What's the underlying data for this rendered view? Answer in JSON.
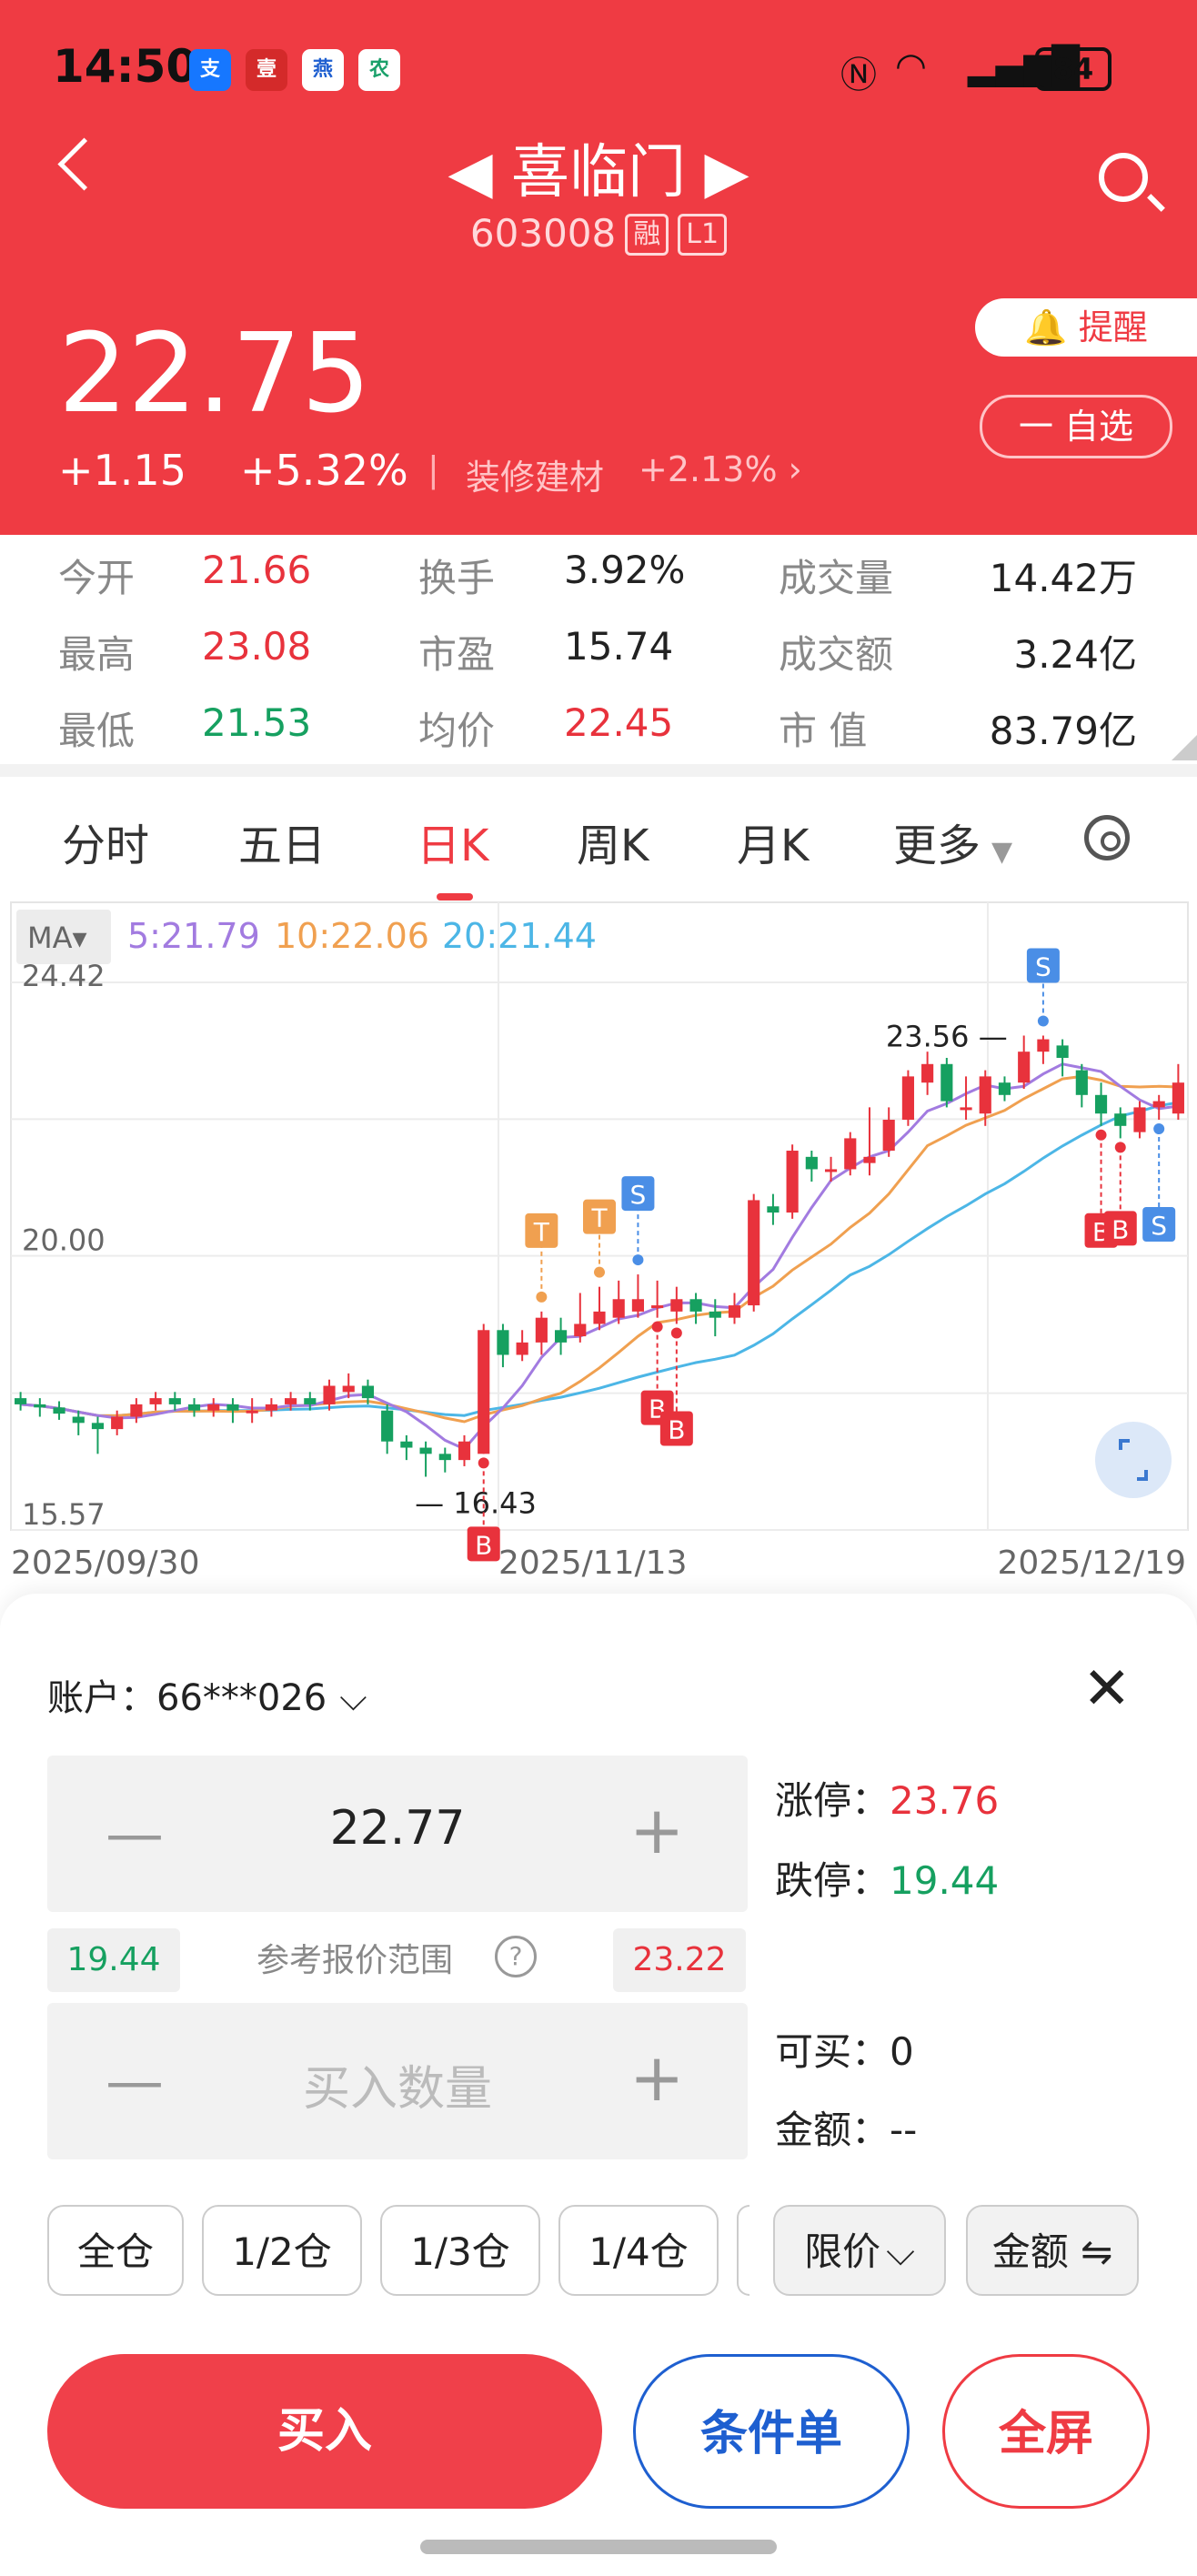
{
  "status_bar": {
    "time": "14:50",
    "battery": "84",
    "apps": [
      "支",
      "壹",
      "燕",
      "农"
    ]
  },
  "header": {
    "title": "◀ 喜临门 ▶",
    "code": "603008",
    "tag1": "融",
    "tag2": "L1",
    "price": "22.75",
    "change": "+1.15",
    "change_pct": "+5.32%",
    "sector": "装修建材",
    "sector_pct": "+2.13% ›",
    "remind": "提醒",
    "watchlist": "一 自选"
  },
  "stats": {
    "open_label": "今开",
    "open": "21.66",
    "high_label": "最高",
    "high": "23.08",
    "low_label": "最低",
    "low": "21.53",
    "turnover_label": "换手",
    "turnover": "3.92%",
    "pe_label": "市盈",
    "pe": "15.74",
    "avg_label": "均价",
    "avg": "22.45",
    "vol_label": "成交量",
    "vol": "14.42万",
    "amount_label": "成交额",
    "amount": "3.24亿",
    "mcap_label": "市 值",
    "mcap": "83.79亿"
  },
  "tabs": [
    "分时",
    "五日",
    "日K",
    "周K",
    "月K",
    "更多"
  ],
  "active_tab": "日K",
  "chart_data": {
    "type": "candlestick",
    "ma_button": "MA",
    "ma5": "5:21.79",
    "ma10": "10:22.06",
    "ma20": "20:21.44",
    "y_ticks": [
      "24.42",
      "20.00",
      "15.57"
    ],
    "ylim": [
      15.57,
      24.42
    ],
    "x_labels": [
      "2025/09/30",
      "2025/11/13",
      "2025/12/19"
    ],
    "max_label": "23.56",
    "min_label": "16.43",
    "colors": {
      "ma5": "#a27be0",
      "ma10": "#f0a050",
      "ma20": "#4cb6e6",
      "up": "#e8323c",
      "down": "#16a060"
    },
    "candles": [
      [
        17.7,
        17.6,
        17.8,
        17.5
      ],
      [
        17.6,
        17.55,
        17.7,
        17.4
      ],
      [
        17.55,
        17.45,
        17.65,
        17.35
      ],
      [
        17.4,
        17.3,
        17.5,
        17.1
      ],
      [
        17.3,
        17.2,
        17.4,
        16.8
      ],
      [
        17.2,
        17.4,
        17.5,
        17.1
      ],
      [
        17.4,
        17.6,
        17.7,
        17.3
      ],
      [
        17.6,
        17.7,
        17.8,
        17.5
      ],
      [
        17.7,
        17.6,
        17.8,
        17.5
      ],
      [
        17.6,
        17.5,
        17.7,
        17.4
      ],
      [
        17.5,
        17.6,
        17.7,
        17.4
      ],
      [
        17.6,
        17.5,
        17.7,
        17.3
      ],
      [
        17.5,
        17.5,
        17.7,
        17.3
      ],
      [
        17.5,
        17.6,
        17.7,
        17.4
      ],
      [
        17.6,
        17.7,
        17.8,
        17.5
      ],
      [
        17.7,
        17.6,
        17.8,
        17.5
      ],
      [
        17.6,
        17.9,
        18.0,
        17.5
      ],
      [
        17.8,
        17.9,
        18.1,
        17.7
      ],
      [
        17.9,
        17.7,
        18.0,
        17.6
      ],
      [
        17.5,
        17.0,
        17.6,
        16.8
      ],
      [
        17.0,
        16.9,
        17.1,
        16.7
      ],
      [
        16.9,
        16.8,
        17.0,
        16.43
      ],
      [
        16.8,
        16.7,
        16.9,
        16.5
      ],
      [
        16.7,
        17.0,
        17.1,
        16.6
      ],
      [
        16.8,
        18.8,
        18.9,
        16.8
      ],
      [
        18.8,
        18.4,
        18.9,
        18.2
      ],
      [
        18.4,
        18.6,
        18.8,
        18.3
      ],
      [
        18.6,
        19.0,
        19.1,
        18.4
      ],
      [
        18.8,
        18.6,
        19.0,
        18.4
      ],
      [
        18.7,
        18.9,
        19.4,
        18.6
      ],
      [
        18.9,
        19.1,
        19.5,
        18.8
      ],
      [
        19.0,
        19.3,
        19.6,
        18.9
      ],
      [
        19.1,
        19.3,
        19.7,
        19.0
      ],
      [
        19.2,
        19.2,
        19.6,
        19.0
      ],
      [
        19.1,
        19.3,
        19.5,
        18.9
      ],
      [
        19.3,
        19.1,
        19.4,
        18.9
      ],
      [
        19.1,
        19.0,
        19.3,
        18.7
      ],
      [
        19.0,
        19.2,
        19.4,
        18.9
      ],
      [
        19.2,
        20.9,
        21.0,
        19.1
      ],
      [
        20.8,
        20.7,
        21.0,
        20.5
      ],
      [
        20.7,
        21.7,
        21.8,
        20.6
      ],
      [
        21.6,
        21.4,
        21.7,
        21.2
      ],
      [
        21.4,
        21.4,
        21.6,
        21.2
      ],
      [
        21.4,
        21.9,
        22.0,
        21.3
      ],
      [
        21.5,
        21.6,
        22.4,
        21.3
      ],
      [
        21.7,
        22.2,
        22.4,
        21.6
      ],
      [
        22.2,
        22.9,
        23.0,
        22.1
      ],
      [
        22.8,
        23.1,
        23.3,
        22.6
      ],
      [
        23.1,
        22.5,
        23.2,
        22.4
      ],
      [
        22.4,
        22.4,
        22.9,
        22.2
      ],
      [
        22.3,
        22.9,
        23.0,
        22.1
      ],
      [
        22.8,
        22.6,
        22.9,
        22.5
      ],
      [
        22.8,
        23.3,
        23.56,
        22.7
      ],
      [
        23.3,
        23.5,
        23.56,
        23.1
      ],
      [
        23.4,
        23.2,
        23.5,
        22.9
      ],
      [
        23.0,
        22.6,
        23.1,
        22.4
      ],
      [
        22.6,
        22.3,
        22.8,
        22.1
      ],
      [
        22.3,
        22.1,
        22.4,
        21.9
      ],
      [
        22.0,
        22.4,
        22.5,
        21.9
      ],
      [
        22.4,
        22.5,
        22.6,
        22.2
      ],
      [
        22.3,
        22.8,
        23.1,
        22.2
      ]
    ],
    "markers": [
      {
        "label": "B",
        "idx": 24,
        "pos": "below",
        "color": "#e8323c"
      },
      {
        "label": "T",
        "idx": 27,
        "pos": "above",
        "color": "#f0a050"
      },
      {
        "label": "T",
        "idx": 30,
        "pos": "above",
        "color": "#f0a050"
      },
      {
        "label": "S",
        "idx": 32,
        "pos": "above",
        "color": "#4a8ee6"
      },
      {
        "label": "B",
        "idx": 33,
        "pos": "below",
        "color": "#e8323c"
      },
      {
        "label": "B",
        "idx": 34,
        "pos": "below",
        "color": "#e8323c"
      },
      {
        "label": "S",
        "idx": 53,
        "pos": "above",
        "color": "#4a8ee6"
      },
      {
        "label": "B",
        "idx": 56,
        "pos": "below",
        "color": "#e8323c"
      },
      {
        "label": "B",
        "idx": 57,
        "pos": "below",
        "color": "#e8323c"
      },
      {
        "label": "S",
        "idx": 59,
        "pos": "below",
        "color": "#4a8ee6"
      }
    ]
  },
  "trade": {
    "account_label": "账户：",
    "account": "66***026",
    "price_value": "22.77",
    "range_low": "19.44",
    "range_label": "参考报价范围",
    "range_high": "23.22",
    "qty_placeholder": "买入数量",
    "limit_up_label": "涨停：",
    "limit_up": "23.76",
    "limit_down_label": "跌停：",
    "limit_down": "19.44",
    "can_buy_label": "可买：",
    "can_buy": "0",
    "amount_label": "金额：",
    "amount": "--",
    "pos_buttons": [
      "全仓",
      "1/2仓",
      "1/3仓",
      "1/4仓"
    ],
    "order_type": "限价",
    "amount_toggle": "金额 ⇋",
    "buy": "买入",
    "conditional": "条件单",
    "fullscreen": "全屏"
  }
}
